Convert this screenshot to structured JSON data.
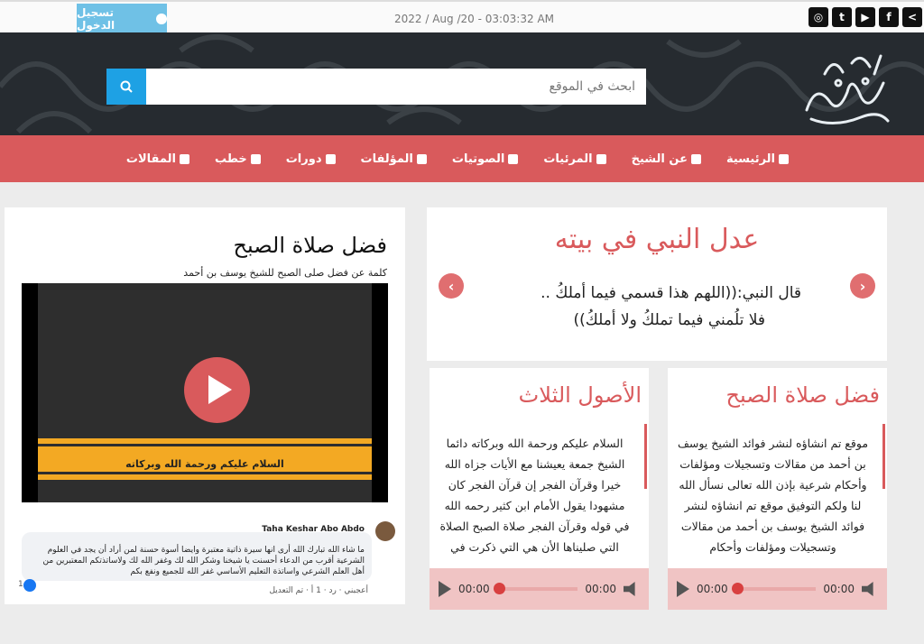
{
  "topbar": {
    "login_label": "تسجيل الدخول",
    "datetime": "2022 / Aug /20 - 03:03:32 AM",
    "social_icons": [
      "share-icon",
      "facebook-icon",
      "youtube-icon",
      "twitter-icon",
      "instagram-icon"
    ]
  },
  "search": {
    "placeholder": "ابحث في الموقع"
  },
  "nav": {
    "items": [
      {
        "label": "الرئيسية",
        "icon": "home-icon"
      },
      {
        "label": "عن الشيخ",
        "icon": "user-icon"
      },
      {
        "label": "المرئيات",
        "icon": "play-circle-icon"
      },
      {
        "label": "الصوتيات",
        "icon": "headphones-icon"
      },
      {
        "label": "المؤلفات",
        "icon": "book-icon"
      },
      {
        "label": "دورات",
        "icon": "presentation-icon"
      },
      {
        "label": "خطب",
        "icon": "mosque-icon"
      },
      {
        "label": "المقالات",
        "icon": "list-icon"
      }
    ]
  },
  "slider": {
    "title": "عدل النبي في بيته",
    "quote_line1": "قال النبي:((اللهم هذا قسمي فيما أملكُ ..",
    "quote_line2": "فلا تلُمني فيما تملكُ ولا أملكُ))"
  },
  "cards": [
    {
      "title": "فضل صلاة الصبح",
      "text": "موقع تم انشاؤه لنشر فوائد الشيخ يوسف بن أحمد من مقالات وتسجيلات ومؤلفات وأحكام شرعية بإذن الله تعالى نسأل الله لنا ولكم التوفيق موقع تم انشاؤه لنشر فوائد الشيخ يوسف بن أحمد من مقالات وتسجيلات ومؤلفات وأحكام",
      "time_current": "00:00",
      "time_total": "00:00"
    },
    {
      "title": "الأصول الثلاث",
      "text": "السلام عليكم ورحمة الله وبركاته دائما الشيخ جمعة يعيشنا مع الأيات جزاه الله خيرا وقرآن الفجر إن قرآن الفجر كان مشهودا يقول الأمام ابن كثير رحمه الله في قوله وقرآن الفجر صلاة الصبح الصلاة التي صليناها الأن هي التي ذكرت في",
      "time_current": "00:00",
      "time_total": "00:00"
    }
  ],
  "side": {
    "title": "فضل صلاة الصبح",
    "subtitle": "كلمة عن فضل صلى الصبح للشيخ يوسف بن أحمد",
    "video_banner": "السلام عليكم ورحمة الله وبركاته"
  },
  "comment": {
    "author": "Taha Keshar Abo Abdo",
    "text": "ما شاء الله تبارك الله أرى انها سيرة ذاتية معتبرة وايضا أسوة حسنة لمن أراد أن يجد في العلوم الشرعية أقرب من الدعاء أحسنت يا شيخنا وشكر الله لك وغفر الله لك ولاساتذتكم المعتبرين من أهل العلم الشرعي واساتذة التعليم الأساسي غفر الله للجميع ونفع بكم",
    "meta": "أعجبني · رد · 1 أ · تم التعديل",
    "likes": "1"
  }
}
